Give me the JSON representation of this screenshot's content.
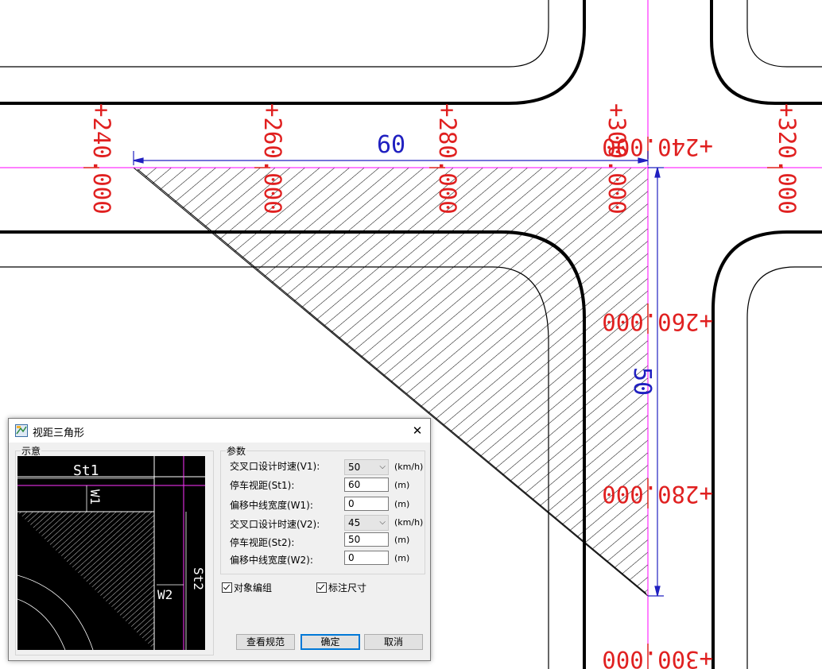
{
  "drawing": {
    "stations_top": [
      "+240.000",
      "+260.000",
      "+280.000",
      "+300.000",
      "+320.000"
    ],
    "stations_right": [
      "+240.000",
      "+260.000",
      "+280.000",
      "+300.000"
    ],
    "dim_horizontal": "60",
    "dim_vertical": "50",
    "colors": {
      "axis": "#ff00ff",
      "station": "#e02020",
      "dimension": "#2020c0",
      "road": "#000000"
    }
  },
  "dialog": {
    "title": "视距三角形",
    "close_icon": "close-icon",
    "preview_group_label": "示意",
    "preview_labels": {
      "st1": "St1",
      "st2": "St2",
      "w1": "W1",
      "w2": "W2"
    },
    "params_group_label": "参数",
    "params": [
      {
        "label": "交叉口设计时速(V1):",
        "value": "50",
        "unit": "(km/h)",
        "kind": "select"
      },
      {
        "label": "停车视距(St1):",
        "value": "60",
        "unit": "(m)",
        "kind": "input"
      },
      {
        "label": "偏移中线宽度(W1):",
        "value": "0",
        "unit": "(m)",
        "kind": "input"
      },
      {
        "label": "交叉口设计时速(V2):",
        "value": "45",
        "unit": "(km/h)",
        "kind": "select"
      },
      {
        "label": "停车视距(St2):",
        "value": "50",
        "unit": "(m)",
        "kind": "input"
      },
      {
        "label": "偏移中线宽度(W2):",
        "value": "0",
        "unit": "(m)",
        "kind": "input"
      }
    ],
    "checkboxes": [
      {
        "label": "对象编组",
        "checked": true
      },
      {
        "label": "标注尺寸",
        "checked": true
      }
    ],
    "buttons": {
      "view_spec": "查看规范",
      "ok": "确定",
      "cancel": "取消"
    }
  }
}
